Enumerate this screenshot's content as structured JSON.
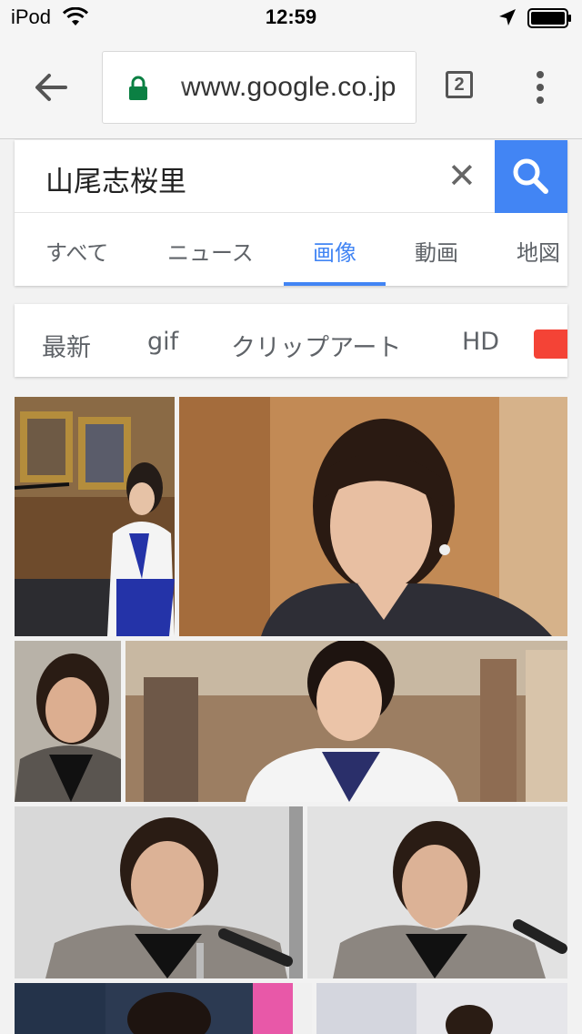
{
  "status_bar": {
    "carrier": "iPod",
    "time": "12:59"
  },
  "toolbar": {
    "url_text": "www.google.co.jp",
    "tab_count": "2"
  },
  "search": {
    "query": "山尾志桜里"
  },
  "search_tabs": [
    {
      "label": "すべて"
    },
    {
      "label": "ニュース"
    },
    {
      "label": "画像"
    },
    {
      "label": "動画"
    },
    {
      "label": "地図"
    }
  ],
  "filter_chips": [
    {
      "label": "最新"
    },
    {
      "label": "gif"
    },
    {
      "label": "クリップアート"
    },
    {
      "label": "HD"
    }
  ],
  "colors": {
    "accent": "#4285f4",
    "red_chip": "#f44336"
  }
}
